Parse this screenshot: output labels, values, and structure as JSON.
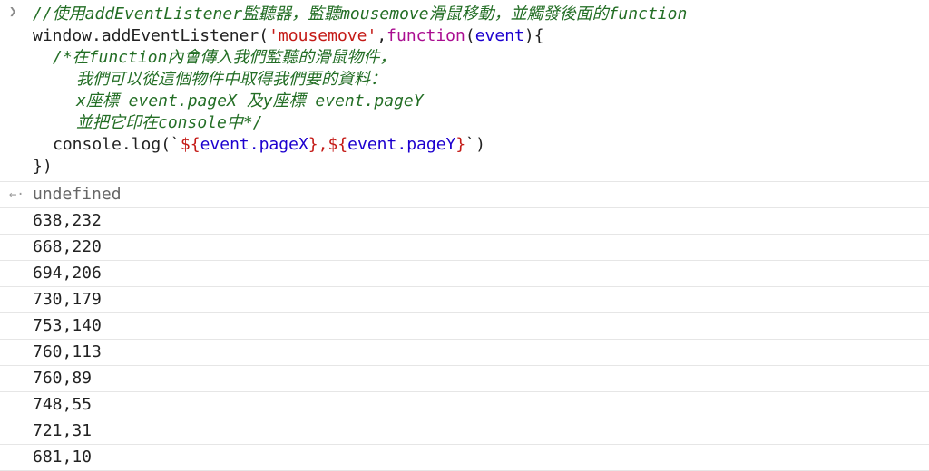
{
  "input": {
    "prompt_icon": "chevron-right-icon",
    "lines": {
      "l1_comment": "//使用addEventListener監聽器，監聽mousemove滑鼠移動，並觸發後面的function",
      "l2_a": "window.addEventListener(",
      "l2_b": "'mousemove'",
      "l2_c": ",",
      "l2_d": "function",
      "l2_e": "(",
      "l2_f": "event",
      "l2_g": "){",
      "l3": "/*在function內會傳入我們監聽的滑鼠物件，",
      "l4": "我們可以從這個物件中取得我們要的資料：",
      "l5": "x座標 event.pageX 及y座標 event.pageY",
      "l6": "並把它印在console中*/",
      "l7_a": "console.log(`",
      "l7_b": "${",
      "l7_c": "event.pageX",
      "l7_d": "}",
      "l7_e": ",",
      "l7_f": "${",
      "l7_g": "event.pageY",
      "l7_h": "}",
      "l7_i": "`)",
      "l8": "})"
    }
  },
  "result": {
    "prompt_icon": "return-arrow-icon",
    "value": "undefined"
  },
  "logs": [
    "638,232",
    "668,220",
    "694,206",
    "730,179",
    "753,140",
    "760,113",
    "760,89",
    "748,55",
    "721,31",
    "681,10"
  ],
  "colors": {
    "comment": "#236e25",
    "string": "#c41a16",
    "keyword": "#aa0d91",
    "param": "#1c00cf"
  }
}
